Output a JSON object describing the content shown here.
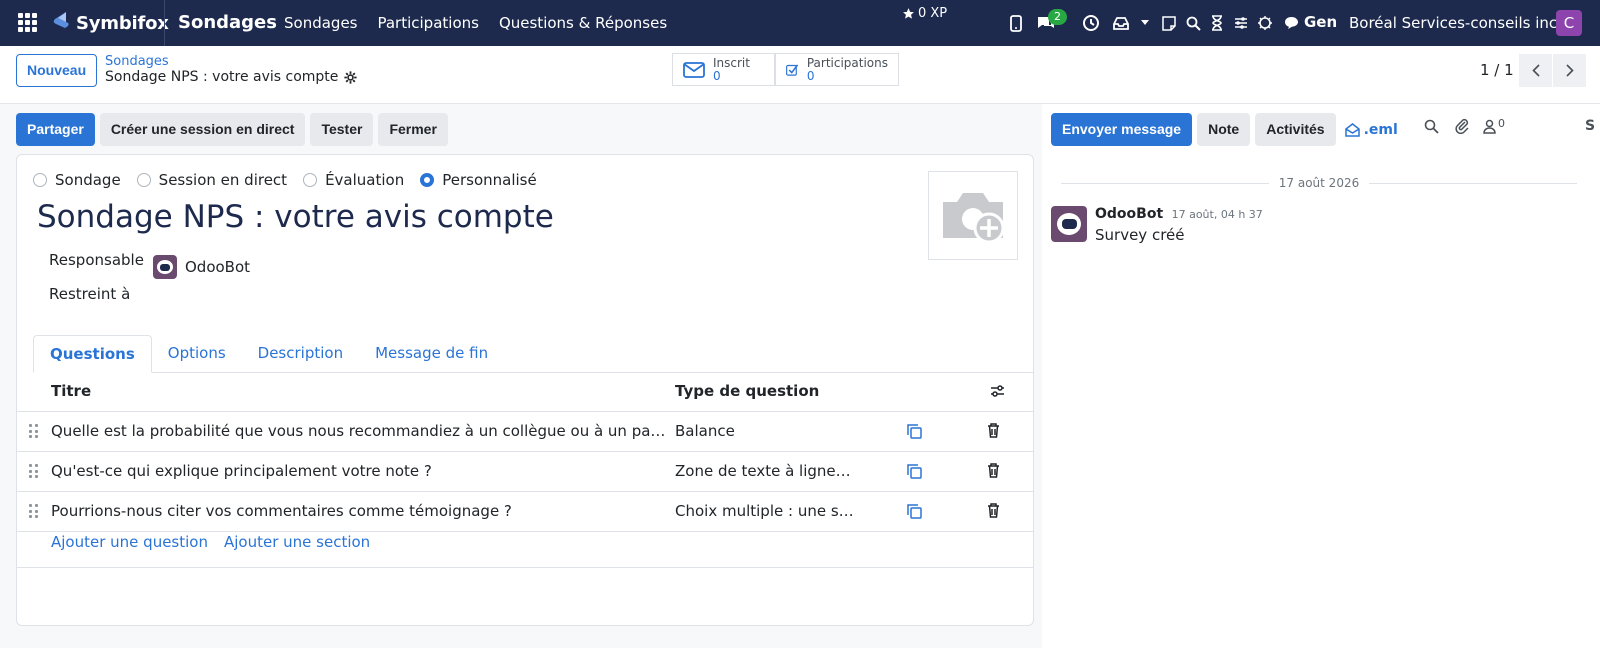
{
  "nav": {
    "brand": "Symbifox",
    "app_name": "Sondages",
    "menu": [
      "Sondages",
      "Participations",
      "Questions & Réponses"
    ],
    "xp": "0 XP",
    "messages_badge": "2",
    "gen_label": "Gen",
    "company": "Boréal Services-conseils inc.",
    "avatar_letter": "C"
  },
  "control": {
    "new_button": "Nouveau",
    "breadcrumb_parent": "Sondages",
    "breadcrumb_current": "Sondage NPS : votre avis compte",
    "stats": [
      {
        "label": "Inscrit",
        "value": "0"
      },
      {
        "label": "Participations",
        "value": "0"
      }
    ],
    "pager": "1 / 1"
  },
  "actions": {
    "share": "Partager",
    "live_session": "Créer une session en direct",
    "test": "Tester",
    "close": "Fermer"
  },
  "form": {
    "types": [
      {
        "label": "Sondage",
        "selected": false
      },
      {
        "label": "Session en direct",
        "selected": false
      },
      {
        "label": "Évaluation",
        "selected": false
      },
      {
        "label": "Personnalisé",
        "selected": true
      }
    ],
    "title": "Sondage NPS : votre avis compte",
    "responsible_label": "Responsable",
    "responsible_value": "OdooBot",
    "restricted_label": "Restreint à",
    "tabs": [
      "Questions",
      "Options",
      "Description",
      "Message de fin"
    ],
    "columns": {
      "title": "Titre",
      "type": "Type de question"
    },
    "questions": [
      {
        "title": "Quelle est la probabilité que vous nous recommandiez à un collègue ou à un partenaire d'affaires ?",
        "type": "Balance"
      },
      {
        "title": "Qu'est-ce qui explique principalement votre note ?",
        "type": "Zone de texte à lignes multiples"
      },
      {
        "title": "Pourrions-nous citer vos commentaires comme témoignage ?",
        "type": "Choix multiple : une seule réponse"
      }
    ],
    "add_question": "Ajouter une question",
    "add_section": "Ajouter une section"
  },
  "chatter": {
    "send_message": "Envoyer message",
    "note": "Note",
    "activities": "Activités",
    "eml": ".eml",
    "followers_count": "0",
    "overflow_label": "S",
    "date": "17 août 2026",
    "messages": [
      {
        "author": "OdooBot",
        "time": "17 août, 04 h 37",
        "body": "Survey créé"
      }
    ]
  }
}
